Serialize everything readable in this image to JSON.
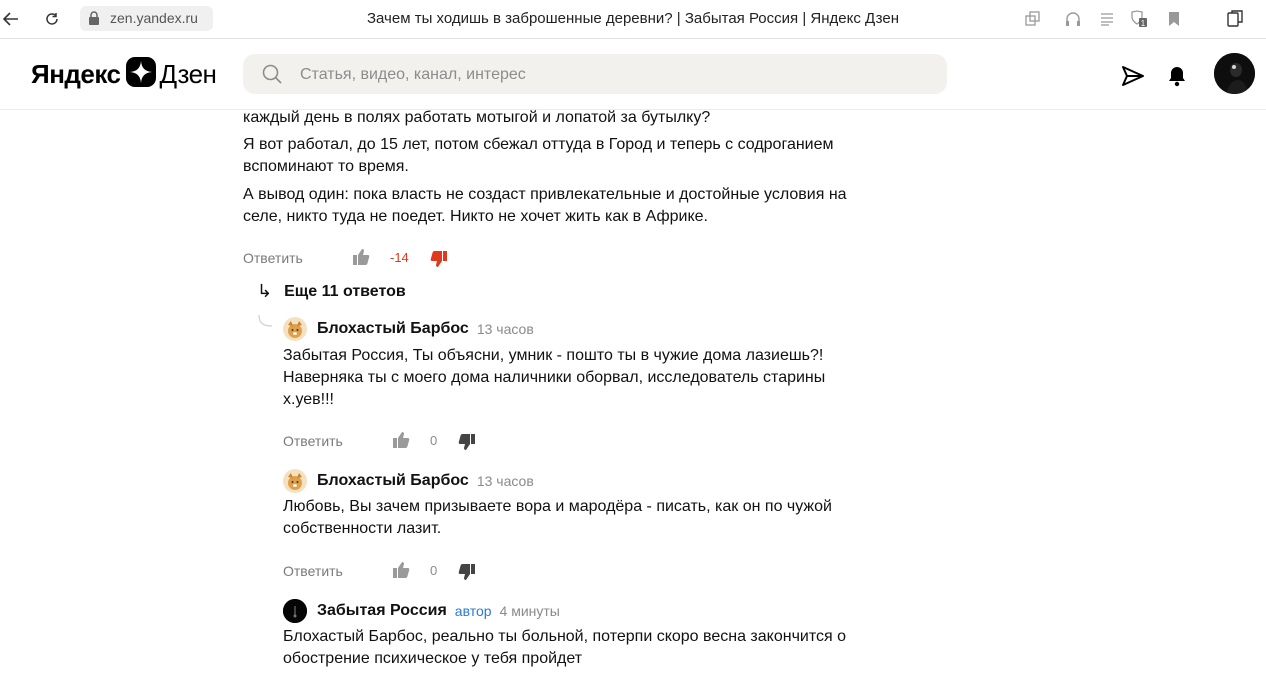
{
  "browser": {
    "url": "zen.yandex.ru",
    "tab_title": "Зачем ты ходишь в заброшенные деревни? | Забытая Россия | Яндекс Дзен"
  },
  "header": {
    "logo_left": "Яндекс",
    "logo_right": "Дзен",
    "search_placeholder": "Статья, видео, канал, интерес"
  },
  "comment_top": {
    "paragraphs": [
      "каждый день в полях работать мотыгой и лопатой за бутылку?",
      "Я вот работал, до 15 лет, потом сбежал оттуда в Город и теперь с содроганием вспоминают то время.",
      "А вывод один: пока власть не создаст привлекательные и достойные условия на селе, никто туда не поедет. Никто не хочет жить как в Африке."
    ],
    "reply_label": "Ответить",
    "score": "-14",
    "score_color": "#e03a1e"
  },
  "more_replies": "Еще 11 ответов",
  "replies": [
    {
      "author": "Блохастый Барбос",
      "time": "13 часов",
      "text": "Забытая Россия, Ты объясни, умник - пошто ты в чужие дома лазиешь?! Наверняка ты с моего дома наличники оборвал, исследователь старины х.уев!!!",
      "reply_label": "Ответить",
      "score": "0"
    },
    {
      "author": "Блохастый Барбос",
      "time": "13 часов",
      "text": "Любовь, Вы зачем призываете вора и мародёра - писать, как он по чужой собственности лазит.",
      "reply_label": "Ответить",
      "score": "0"
    },
    {
      "author": "Забытая Россия",
      "author_badge": "автор",
      "time": "4 минуты",
      "text": "Блохастый Барбос, реально ты больной, потерпи скоро весна закончится о обострение психическое у тебя пройдет"
    }
  ],
  "colors": {
    "accent_blue": "#2a7bd1",
    "negative": "#e03a1e",
    "search_bg": "#f2f1ee"
  }
}
